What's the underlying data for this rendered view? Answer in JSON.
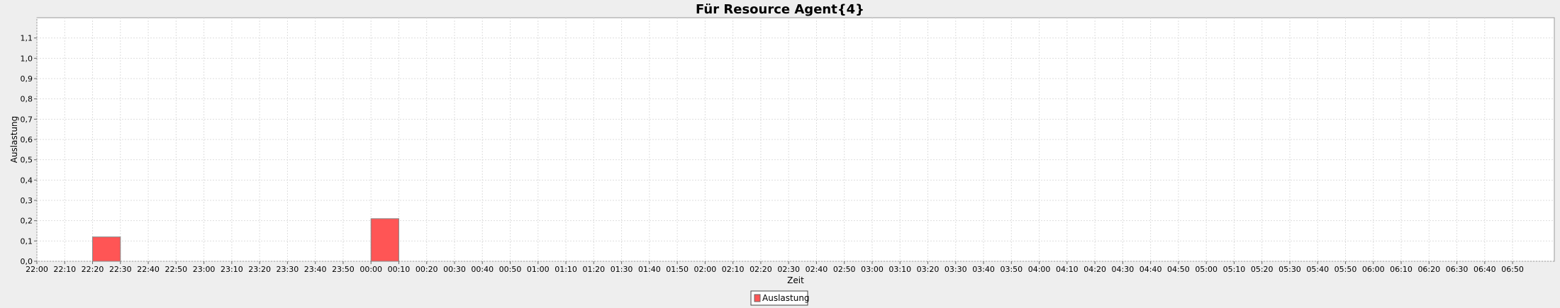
{
  "chart_data": {
    "type": "bar",
    "title": "Für Resource Agent{4}",
    "xlabel": "Zeit",
    "ylabel": "Auslastung",
    "x_ticks": [
      "22:00",
      "22:10",
      "22:20",
      "22:30",
      "22:40",
      "22:50",
      "23:00",
      "23:10",
      "23:20",
      "23:30",
      "23:40",
      "23:50",
      "00:00",
      "00:10",
      "00:20",
      "00:30",
      "00:40",
      "00:50",
      "01:00",
      "01:10",
      "01:20",
      "01:30",
      "01:40",
      "01:50",
      "02:00",
      "02:10",
      "02:20",
      "02:30",
      "02:40",
      "02:50",
      "03:00",
      "03:10",
      "03:20",
      "03:30",
      "03:40",
      "03:50",
      "04:00",
      "04:10",
      "04:20",
      "04:30",
      "04:40",
      "04:50",
      "05:00",
      "05:10",
      "05:20",
      "05:30",
      "05:40",
      "05:50",
      "06:00",
      "06:10",
      "06:20",
      "06:30",
      "06:40",
      "06:50"
    ],
    "y_ticks": [
      "0,0",
      "0,1",
      "0,2",
      "0,3",
      "0,4",
      "0,5",
      "0,6",
      "0,7",
      "0,8",
      "0,9",
      "1,0",
      "1,1"
    ],
    "ylim": [
      0,
      1.2
    ],
    "xlim": [
      "22:00",
      "07:05"
    ],
    "grid": true,
    "legend_position": "bottom-center",
    "series": [
      {
        "name": "Auslastung",
        "color": "#ff5555",
        "bars": [
          {
            "start": "22:20",
            "end": "22:30",
            "value": 0.12
          },
          {
            "start": "00:00",
            "end": "00:10",
            "value": 0.21
          }
        ]
      }
    ]
  }
}
